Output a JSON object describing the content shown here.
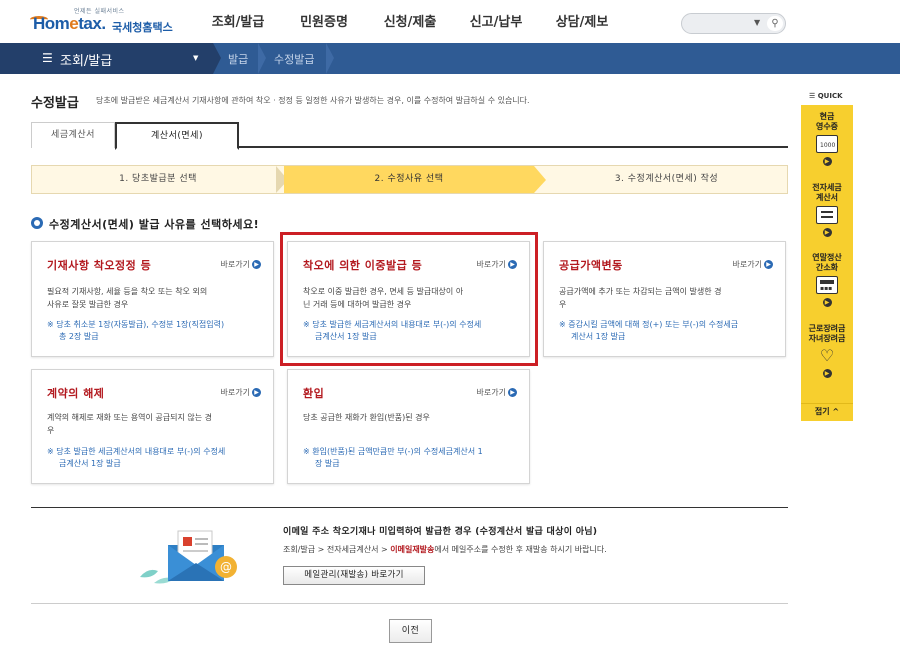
{
  "logo": {
    "small_text": "언제든 실패서비스",
    "english": "Hometax",
    "korean": "국세청홈택스"
  },
  "gnb": [
    "조회/발급",
    "민원증명",
    "신청/제출",
    "신고/납부",
    "상담/제보"
  ],
  "navbar": {
    "menu_label": "조회/발급",
    "crumbs": [
      "발급",
      "수정발급"
    ]
  },
  "page": {
    "title": "수정발급",
    "description": "당초에 발급받은 세금계산서 기재사항에 관하여 착오 · 정정 등 일정한 사유가 발생하는 경우, 이를 수정하여 발급하실 수 있습니다."
  },
  "tabs": [
    {
      "label": "세금계산서",
      "active": false
    },
    {
      "label": "계산서(면세)",
      "active": true
    }
  ],
  "steps": [
    {
      "label": "1. 당초발급분 선택",
      "current": false
    },
    {
      "label": "2. 수정사유 선택",
      "current": true
    },
    {
      "label": "3. 수정계산서(면세) 작성",
      "current": false
    }
  ],
  "section_heading": "수정계산서(면세) 발급 사유를 선택하세요!",
  "go_label": "바로가기",
  "cards": [
    {
      "title": "기재사항 착오정정 등",
      "desc": [
        "필요적 기재사항, 세율 등을 착오 또는 착오 외의",
        "사유로 잘못 발급한 경우"
      ],
      "note": [
        "※ 당초 취소분 1장(자동발급), 수정분 1장(직접입력)",
        "총 2장 발급"
      ]
    },
    {
      "title": "착오에 의한 이중발급 등",
      "desc": [
        "착오로 이중 발급한 경우, 면세 등 발급대상이 아",
        "닌 거래 등에 대하여 발급한 경우"
      ],
      "note": [
        "※ 당초 발급한 세금계산서의 내용대로 부(-)의 수정세",
        "금계산서 1장 발급"
      ]
    },
    {
      "title": "공급가액변동",
      "desc": [
        "공급가액에 추가 또는 차감되는 금액이 발생한 경",
        "우"
      ],
      "note": [
        "※ 증감시킬 금액에 대해 정(+) 또는 부(-)의 수정세금",
        "계산서 1장 발급"
      ]
    },
    {
      "title": "계약의 해제",
      "desc": [
        "계약의 해제로 재화 또는 용역이 공급되지 않는 경",
        "우"
      ],
      "note": [
        "※ 당초 발급한 세금계산서의 내용대로 부(-)의 수정세",
        "금계산서 1장 발급"
      ]
    },
    {
      "title": "환입",
      "desc": [
        "당초 공급한 재화가 환입(반품)된 경우"
      ],
      "note": [
        "※ 환입(반품)된 금액만큼만 부(-)의 수정세금계산서 1",
        "장 발급"
      ]
    }
  ],
  "email": {
    "title": "이메일 주소 착오기재나 미입력하여 발급한 경우 (수정계산서 발급 대상이 아님)",
    "line_pre": "조회/발급 > 전자세금계산서 > ",
    "line_red": "이메일재발송",
    "line_post": "에서 메일주소를 수정한 후 재발송 하시기 바랍니다.",
    "button": "메일관리(재발송) 바로가기"
  },
  "prev_button": "이전",
  "quick": {
    "header": "QUICK",
    "items": [
      {
        "label1": "현금",
        "label2": "영수증",
        "icon": "receipt-icon"
      },
      {
        "label1": "전자세금",
        "label2": "계산서",
        "icon": "document-icon"
      },
      {
        "label1": "연말정산",
        "label2": "간소화",
        "icon": "calculator-icon"
      },
      {
        "label1": "근로장려금",
        "label2": "자녀장려금",
        "icon": "heart-icon"
      }
    ],
    "fold": "접기 ^"
  }
}
